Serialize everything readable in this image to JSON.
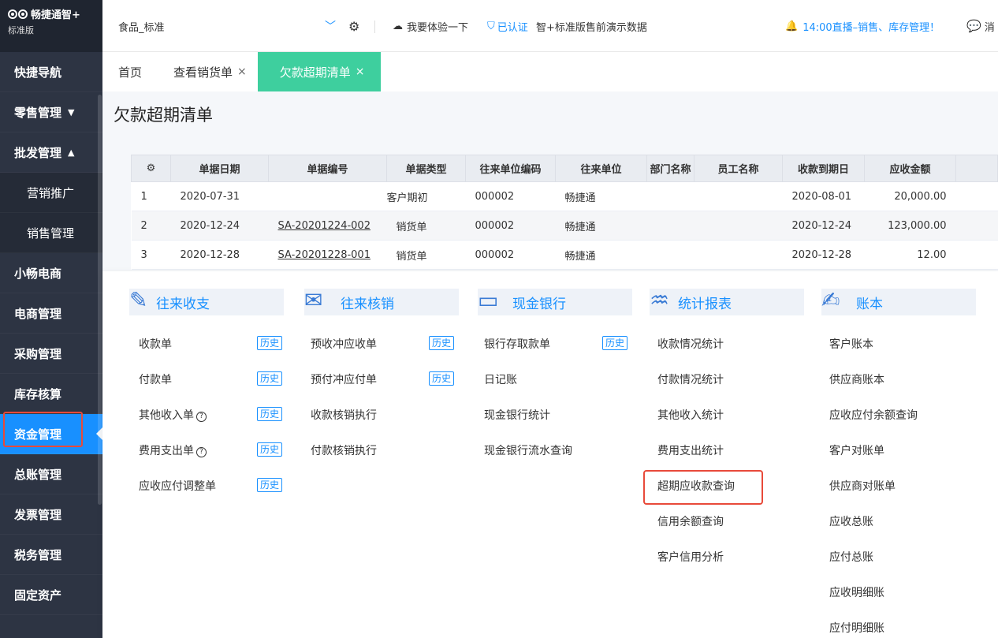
{
  "sidebar": {
    "brand": "畅捷通智+",
    "edition": "标准版",
    "items": [
      {
        "label": "快捷导航"
      },
      {
        "label": "零售管理",
        "arrow": "▼"
      },
      {
        "label": "批发管理",
        "arrow": "▲"
      },
      {
        "label": "营销推广"
      },
      {
        "label": "销售管理"
      },
      {
        "label": "小畅电商"
      },
      {
        "label": "电商管理"
      },
      {
        "label": "采购管理"
      },
      {
        "label": "库存核算"
      },
      {
        "label": "资金管理"
      },
      {
        "label": "总账管理"
      },
      {
        "label": "发票管理"
      },
      {
        "label": "税务管理"
      },
      {
        "label": "固定资产"
      }
    ]
  },
  "topbar": {
    "company": "食品_标准",
    "try_label": "我要体验一下",
    "verified_label": "已认证",
    "edition_label": "智+标准版售前演示数据",
    "live_label": "14:00直播–销售、库存管理！",
    "msg_label": "消"
  },
  "tabs": [
    {
      "label": "首页"
    },
    {
      "label": "查看销货单",
      "close": "×"
    },
    {
      "label": "欠款超期清单",
      "close": "×"
    }
  ],
  "page": {
    "title": "欠款超期清单"
  },
  "table": {
    "headers": [
      "单据日期",
      "单据编号",
      "单据类型",
      "往来单位编码",
      "往来单位",
      "部门名称",
      "员工名称",
      "收款到期日",
      "应收金额"
    ],
    "rows": [
      {
        "no": "1",
        "date": "2020-07-31",
        "code": "",
        "type": "客户期初",
        "unit_code": "000002",
        "unit": "畅捷通",
        "dept": "",
        "staff": "",
        "due": "2020-08-01",
        "amount": "20,000.00"
      },
      {
        "no": "2",
        "date": "2020-12-24",
        "code": "SA-20201224-002",
        "type": "销货单",
        "unit_code": "000002",
        "unit": "畅捷通",
        "dept": "",
        "staff": "",
        "due": "2020-12-24",
        "amount": "123,000.00"
      },
      {
        "no": "3",
        "date": "2020-12-28",
        "code": "SA-20201228-001",
        "type": "销货单",
        "unit_code": "000002",
        "unit": "畅捷通",
        "dept": "",
        "staff": "",
        "due": "2020-12-28",
        "amount": "12.00"
      }
    ]
  },
  "menu": {
    "history_label": "历史",
    "columns": [
      {
        "title": "往来收支",
        "items": [
          "收款单",
          "付款单",
          "其他收入单",
          "费用支出单",
          "应收应付调整单"
        ]
      },
      {
        "title": "往来核销",
        "items": [
          "预收冲应收单",
          "预付冲应付单",
          "收款核销执行",
          "付款核销执行"
        ]
      },
      {
        "title": "现金银行",
        "items": [
          "银行存取款单",
          "日记账",
          "现金银行统计",
          "现金银行流水查询"
        ]
      },
      {
        "title": "统计报表",
        "items": [
          "收款情况统计",
          "付款情况统计",
          "其他收入统计",
          "费用支出统计",
          "超期应收款查询",
          "信用余额查询",
          "客户信用分析"
        ]
      },
      {
        "title": "账本",
        "items": [
          "客户账本",
          "供应商账本",
          "应收应付余额查询",
          "客户对账单",
          "供应商对账单",
          "应收总账",
          "应付总账",
          "应收明细账",
          "应付明细账"
        ]
      }
    ]
  },
  "colors": {
    "accent": "#1890ff",
    "active_tab": "#3ecf9e",
    "sidebar": "#2d3443",
    "highlight": "#e84a3a"
  }
}
